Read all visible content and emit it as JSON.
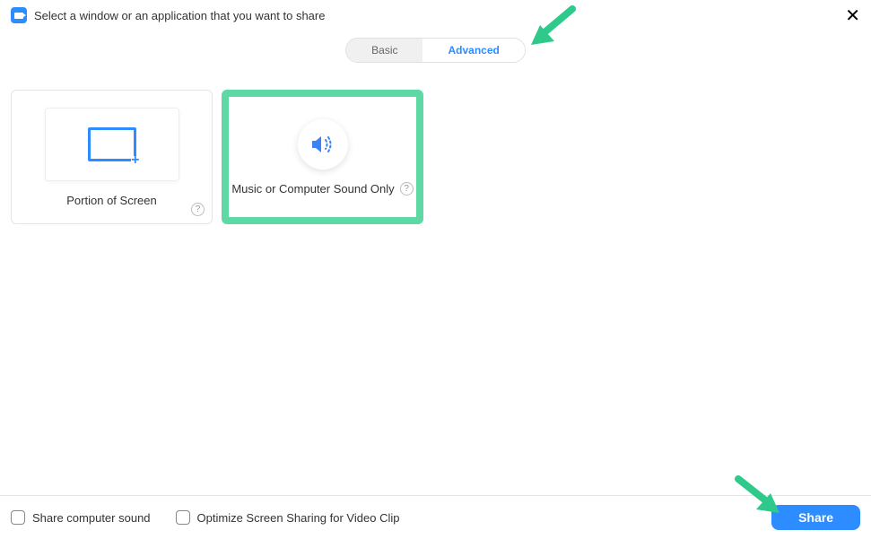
{
  "header": {
    "title": "Select a window or an application that you want to share"
  },
  "tabs": {
    "basic": "Basic",
    "advanced": "Advanced"
  },
  "options": {
    "portion": {
      "label": "Portion of Screen"
    },
    "sound": {
      "label": "Music or Computer Sound Only"
    }
  },
  "footer": {
    "share_sound": "Share computer sound",
    "optimize": "Optimize Screen Sharing for Video Clip",
    "share_button": "Share"
  }
}
